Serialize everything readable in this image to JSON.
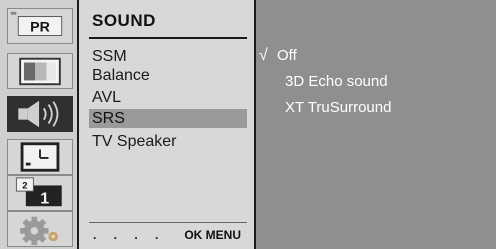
{
  "sidebar": {
    "icons": [
      {
        "name": "picture-pr-icon",
        "label": "PR"
      },
      {
        "name": "screen-icon"
      },
      {
        "name": "sound-icon"
      },
      {
        "name": "time-icon"
      },
      {
        "name": "channel-number-icon",
        "small": "2",
        "big": "1"
      },
      {
        "name": "settings-gear-icon"
      }
    ],
    "active_index": 2
  },
  "menu": {
    "title": "SOUND",
    "items": [
      "SSM",
      "Balance",
      "AVL",
      "SRS",
      "TV Speaker"
    ],
    "selected": "SRS",
    "footer_dots": ". . . .",
    "footer_hint": "OK MENU"
  },
  "options": {
    "check_mark": "√",
    "items": [
      "Off",
      "3D Echo sound",
      "XT TruSurround"
    ],
    "selected": "Off"
  },
  "colors": {
    "sidebar_bg": "#cfcfcf",
    "menu_bg": "#d8d8d8",
    "options_bg": "#8f8f8f",
    "highlight": "#9a9a9a",
    "active_icon_bg": "#303030"
  }
}
